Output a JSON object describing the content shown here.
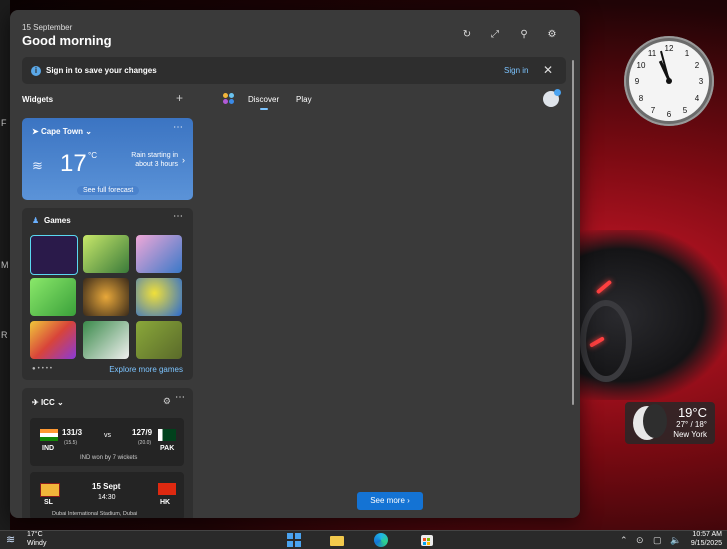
{
  "desktop": {
    "edge_letters": [
      "F",
      "M",
      "R"
    ],
    "clock": {
      "numbers": [
        "12",
        "1",
        "2",
        "3",
        "4",
        "5",
        "6",
        "7",
        "8",
        "9",
        "10",
        "11"
      ]
    },
    "weather_gadget": {
      "temp": "19°C",
      "range": "27° / 18°",
      "city": "New York"
    }
  },
  "panel": {
    "date": "15 September",
    "greeting": "Good morning",
    "header_icons": [
      "refresh-icon",
      "expand-icon",
      "pin-icon",
      "settings-icon"
    ],
    "signin_bar": {
      "message": "Sign in to save your changes",
      "link": "Sign in"
    },
    "widgets_label": "Widgets",
    "add_label": "+",
    "tabs": [
      {
        "label": "Discover",
        "active": true
      },
      {
        "label": "Play",
        "active": false
      }
    ],
    "weather": {
      "location": "Cape Town",
      "temp": "17",
      "unit": "°C",
      "rain": "Rain starting in about 3 hours",
      "forecast_link": "See full forecast"
    },
    "games": {
      "title": "Games",
      "explore_link": "Explore more games",
      "tile_colors": [
        "#2a1a4a",
        "#5a8a3a",
        "#3a78c8",
        "#5dc45a",
        "#3a2a1a",
        "#2a6ad0",
        "#d8443a",
        "#2f7a3a",
        "#6a8a3a"
      ]
    },
    "icc": {
      "title": "ICC",
      "match1": {
        "team1": "IND",
        "score1": "131/3",
        "overs1": "(15.5)",
        "vs": "vs",
        "team2": "PAK",
        "score2": "127/9",
        "overs2": "(20.0)",
        "result": "IND won by 7 wickets"
      },
      "match2": {
        "team1": "SL",
        "team2": "HK",
        "date": "15 Sept",
        "time": "14:30",
        "venue": "Dubai International Stadium, Dubai"
      }
    },
    "see_more": "See more"
  },
  "taskbar": {
    "temp": "17°C",
    "condition": "Windy",
    "time": "10:57 AM",
    "date": "9/15/2025",
    "apps": [
      "start-icon",
      "file-explorer-icon",
      "edge-icon",
      "store-icon"
    ]
  },
  "colors": {
    "accent": "#1473d4",
    "link": "#7cc4ff",
    "panel_bg": "#3a3a3a",
    "card_bg": "#2f2f2f"
  }
}
